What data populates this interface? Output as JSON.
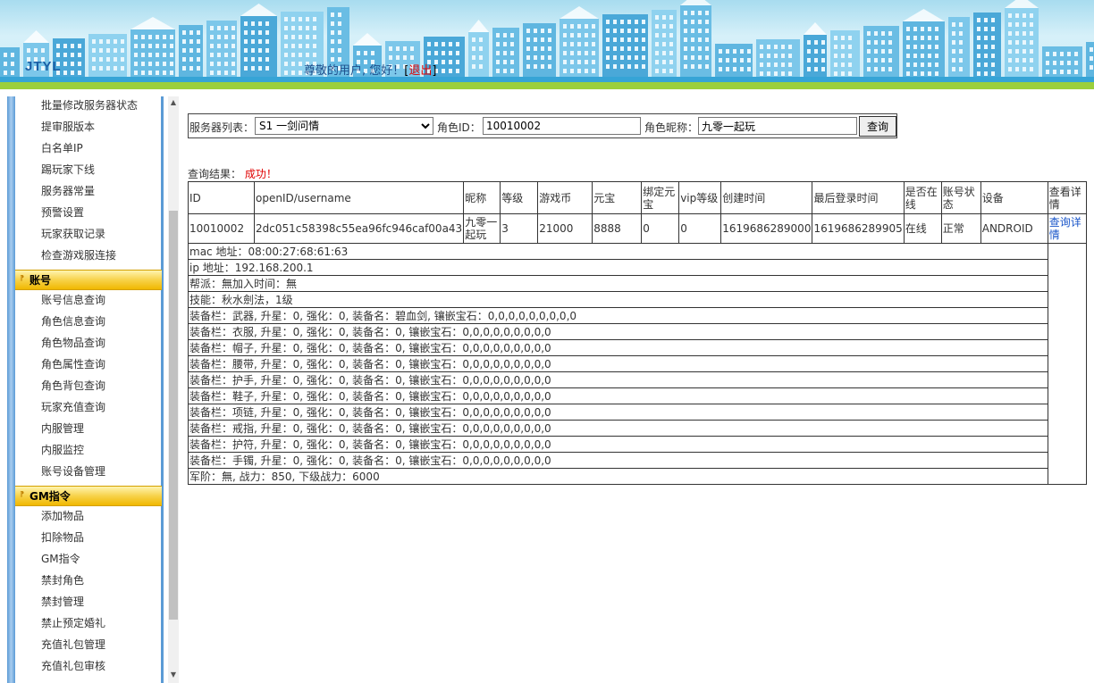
{
  "header": {
    "logo": "JTYL",
    "greeting": "尊敬的用户, 您好！",
    "bracket_open": "[",
    "logout": "退出",
    "bracket_close": "]"
  },
  "sidebar": {
    "items_top": [
      "批量修改服务器状态",
      "提审服版本",
      "白名单IP",
      "踢玩家下线",
      "服务器常量",
      "预警设置",
      "玩家获取记录",
      "检查游戏服连接"
    ],
    "section_account": "账号",
    "items_account": [
      "账号信息查询",
      "角色信息查询",
      "角色物品查询",
      "角色属性查询",
      "角色背包查询",
      "玩家充值查询",
      "内服管理",
      "内服监控",
      "账号设备管理"
    ],
    "section_gm": "GM指令",
    "items_gm": [
      "添加物品",
      "扣除物品",
      "GM指令",
      "禁封角色",
      "禁封管理",
      "禁止预定婚礼",
      "充值礼包管理",
      "充值礼包审核"
    ]
  },
  "search": {
    "server_label": "服务器列表：",
    "server_value": "S1 一剑问情",
    "role_id_label": "角色ID：",
    "role_id_value": "10010002",
    "nickname_label": "角色昵称：",
    "nickname_value": "九零一起玩",
    "query_button": "查询"
  },
  "result": {
    "label": "查询结果：",
    "status": "成功！"
  },
  "table": {
    "headers": [
      "ID",
      "openID/username",
      "昵称",
      "等级",
      "游戏币",
      "元宝",
      "绑定元宝",
      "vip等级",
      "创建时间",
      "最后登录时间",
      "是否在线",
      "账号状态",
      "设备",
      "查看详情"
    ],
    "row": {
      "id": "10010002",
      "openid": "2dc051c58398c55ea96fc946caf00a43",
      "nickname": "九零一起玩",
      "level": "3",
      "coins": "21000",
      "yuanbao": "8888",
      "bound_yuanbao": "0",
      "vip": "0",
      "created": "1619686289000",
      "last_login": "1619686289905",
      "online": "在线",
      "status": "正常",
      "device": "ANDROID",
      "detail_link": "查询详情"
    },
    "details": [
      "mac 地址：08:00:27:68:61:63",
      "ip 地址：192.168.200.1",
      "帮派：無加入时间：無",
      "技能：秋水劍法，1级",
      "装备栏：武器, 升星：0, 强化：0, 装备名：碧血剑, 镶嵌宝石：0,0,0,0,0,0,0,0,0",
      "装备栏：衣服, 升星：0, 强化：0, 装备名：0, 镶嵌宝石：0,0,0,0,0,0,0,0,0",
      "装备栏：帽子, 升星：0, 强化：0, 装备名：0, 镶嵌宝石：0,0,0,0,0,0,0,0,0",
      "装备栏：腰带, 升星：0, 强化：0, 装备名：0, 镶嵌宝石：0,0,0,0,0,0,0,0,0",
      "装备栏：护手, 升星：0, 强化：0, 装备名：0, 镶嵌宝石：0,0,0,0,0,0,0,0,0",
      "装备栏：鞋子, 升星：0, 强化：0, 装备名：0, 镶嵌宝石：0,0,0,0,0,0,0,0,0",
      "装备栏：项链, 升星：0, 强化：0, 装备名：0, 镶嵌宝石：0,0,0,0,0,0,0,0,0",
      "装备栏：戒指, 升星：0, 强化：0, 装备名：0, 镶嵌宝石：0,0,0,0,0,0,0,0,0",
      "装备栏：护符, 升星：0, 强化：0, 装备名：0, 镶嵌宝石：0,0,0,0,0,0,0,0,0",
      "装备栏：手镯, 升星：0, 强化：0, 装备名：0, 镶嵌宝石：0,0,0,0,0,0,0,0,0",
      "军阶：無, 战力：850, 下级战力：6000"
    ]
  },
  "colors": {
    "header_sky": "#a8dcef",
    "header_blue_strip": "#36a4d6",
    "header_green_strip": "#9bcf3c",
    "section_yellow": "#f7d24a",
    "sidebar_blue": "#5b9bd5",
    "link_blue": "#1a56c9",
    "alert_red": "#e00000"
  }
}
